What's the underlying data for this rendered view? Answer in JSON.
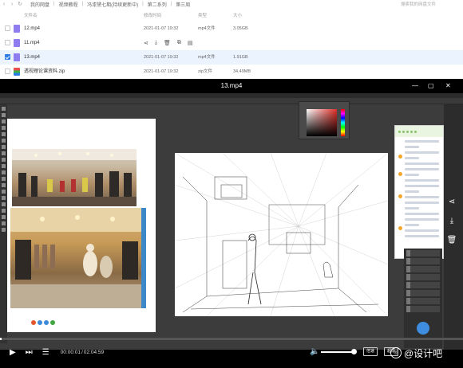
{
  "breadcrumb": [
    "我的网盘",
    "视频教程",
    "冯漆黛七期(持续更新中)",
    "第二系列",
    "第三周"
  ],
  "search": {
    "placeholder": "搜索我的网盘文件"
  },
  "columns": {
    "name": "文件名",
    "date": "修改时间",
    "type": "类型",
    "size": "大小"
  },
  "files": [
    {
      "name": "12.mp4",
      "date": "2021-01-07 19:32",
      "type": "mp4文件",
      "size": "3.05GB",
      "checked": false,
      "selected": false,
      "icon": "video-file-icon"
    },
    {
      "name": "11.mp4",
      "date": "",
      "type": "",
      "size": "",
      "checked": false,
      "selected": false,
      "icon": "video-file-icon",
      "hover_tools": [
        "share-icon",
        "download-icon",
        "delete-icon",
        "copy-icon",
        "more-icon"
      ]
    },
    {
      "name": "13.mp4",
      "date": "2021-01-07 19:32",
      "type": "mp4文件",
      "size": "1.91GB",
      "checked": true,
      "selected": true,
      "icon": "video-file-icon"
    },
    {
      "name": "透视理论课资料.zip",
      "date": "2021-01-07 19:32",
      "type": "zip文件",
      "size": "34.49MB",
      "checked": false,
      "selected": false,
      "icon": "zip-file-icon"
    }
  ],
  "player": {
    "title": "13.mp4",
    "time_current": "00:00:01",
    "time_total": "02:04:59",
    "speed_label": "倍速",
    "quality_label": "超清",
    "progress_fraction": 0.003,
    "volume_fraction": 0.9
  },
  "watermark": "@设计吧",
  "colors": {
    "accent": "#2d7be5",
    "selected_row": "#eaf3fe",
    "player_bg": "#000000"
  }
}
